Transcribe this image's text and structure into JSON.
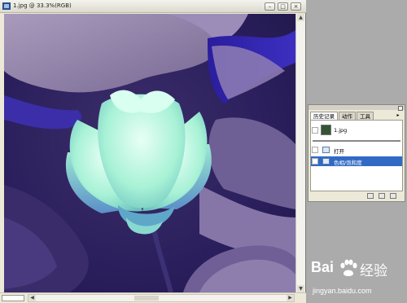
{
  "document": {
    "title": "1.jpg @ 33.3%(RGB)",
    "window_buttons": [
      "–",
      "□",
      "×"
    ]
  },
  "history_palette": {
    "tabs": [
      "历史记录",
      "动作",
      "工具"
    ],
    "snapshot_label": "1.jpg",
    "steps": [
      {
        "label": "打开",
        "selected": false
      },
      {
        "label": "色相/饱和度",
        "selected": true
      }
    ]
  },
  "watermark": {
    "brand_latin": "Bai",
    "brand_cn": "经验",
    "url": "jingyan.baidu.com"
  },
  "colors": {
    "selection": "#316ac5",
    "canvas_purple": "#2a1e6e",
    "flower_cyan": "#9ff0d0"
  }
}
